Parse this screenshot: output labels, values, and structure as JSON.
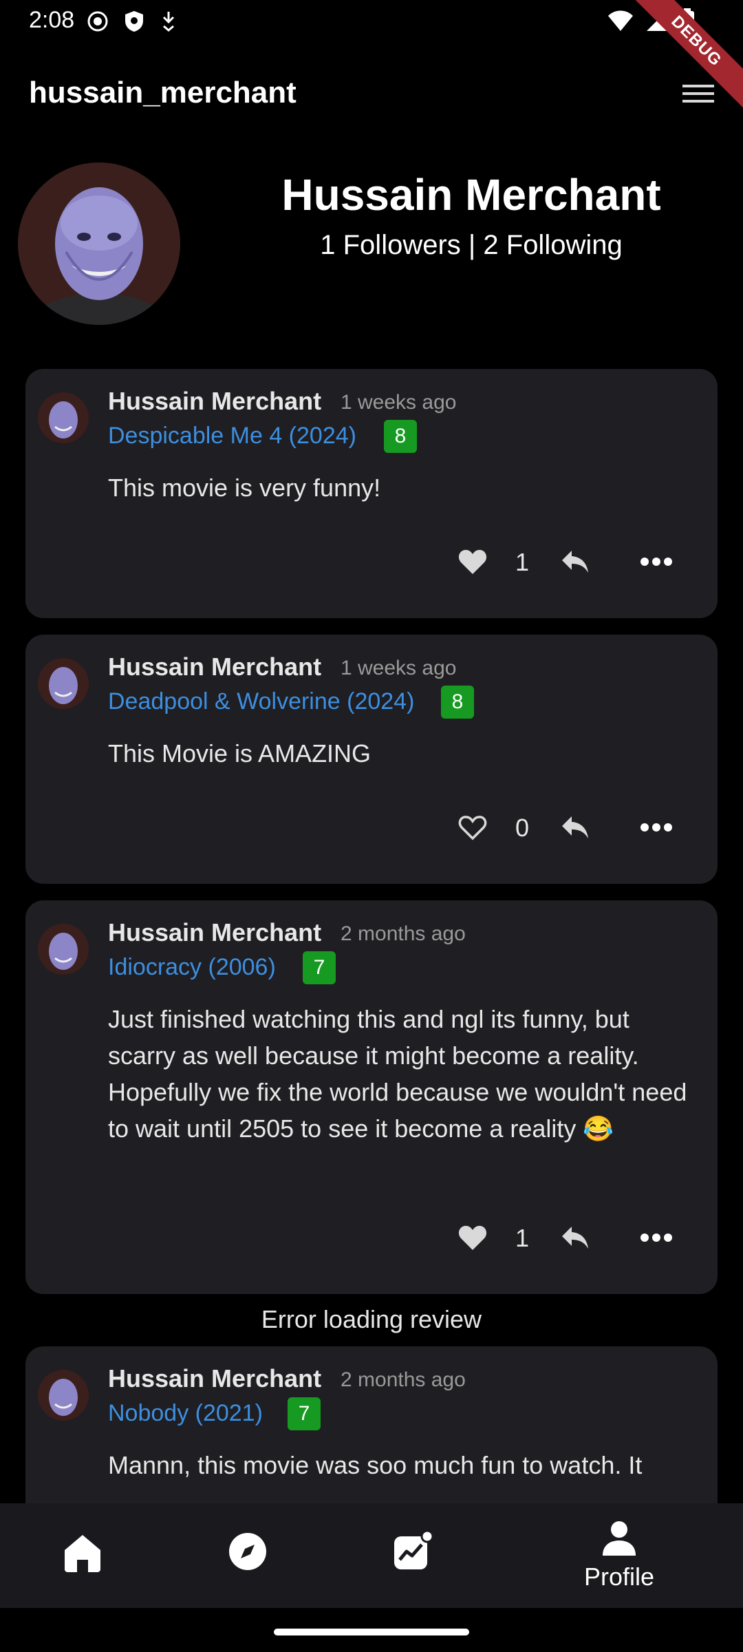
{
  "status_bar": {
    "time": "2:08",
    "debug_label": "DEBUG"
  },
  "app_bar": {
    "title": "hussain_merchant"
  },
  "profile": {
    "name": "Hussain Merchant",
    "followers_text": "1 Followers | 2 Following"
  },
  "reviews": [
    {
      "author": "Hussain Merchant",
      "time": "1 weeks ago",
      "movie": "Despicable Me 4 (2024)",
      "score": "8",
      "text": "This movie is very funny!",
      "likes": "1",
      "liked": true
    },
    {
      "author": "Hussain Merchant",
      "time": "1 weeks ago",
      "movie": "Deadpool & Wolverine (2024)",
      "score": "8",
      "text": "This Movie is AMAZING",
      "likes": "0",
      "liked": false
    },
    {
      "author": "Hussain Merchant",
      "time": "2 months ago",
      "movie": "Idiocracy (2006)",
      "score": "7",
      "text": "Just finished watching this and ngl its funny, but scarry as well because it might become a reality. Hopefully we fix the world because we wouldn't need to wait until 2505 to see it become a reality 😂",
      "likes": "1",
      "liked": true
    },
    {
      "author": "Hussain Merchant",
      "time": "2 months ago",
      "movie": "Nobody (2021)",
      "score": "7",
      "text": "Mannn, this movie was soo much fun to watch. It"
    }
  ],
  "error_message": "Error loading review",
  "bottom_nav": {
    "items": [
      {
        "icon": "home-icon"
      },
      {
        "icon": "explore-icon"
      },
      {
        "icon": "activity-icon"
      },
      {
        "icon": "profile-icon",
        "label": "Profile"
      }
    ]
  },
  "colors": {
    "background": "#000000",
    "card": "#1f1e22",
    "link": "#3d8fe0",
    "score_badge": "#179a22",
    "debug_ribbon": "#a2272f"
  }
}
